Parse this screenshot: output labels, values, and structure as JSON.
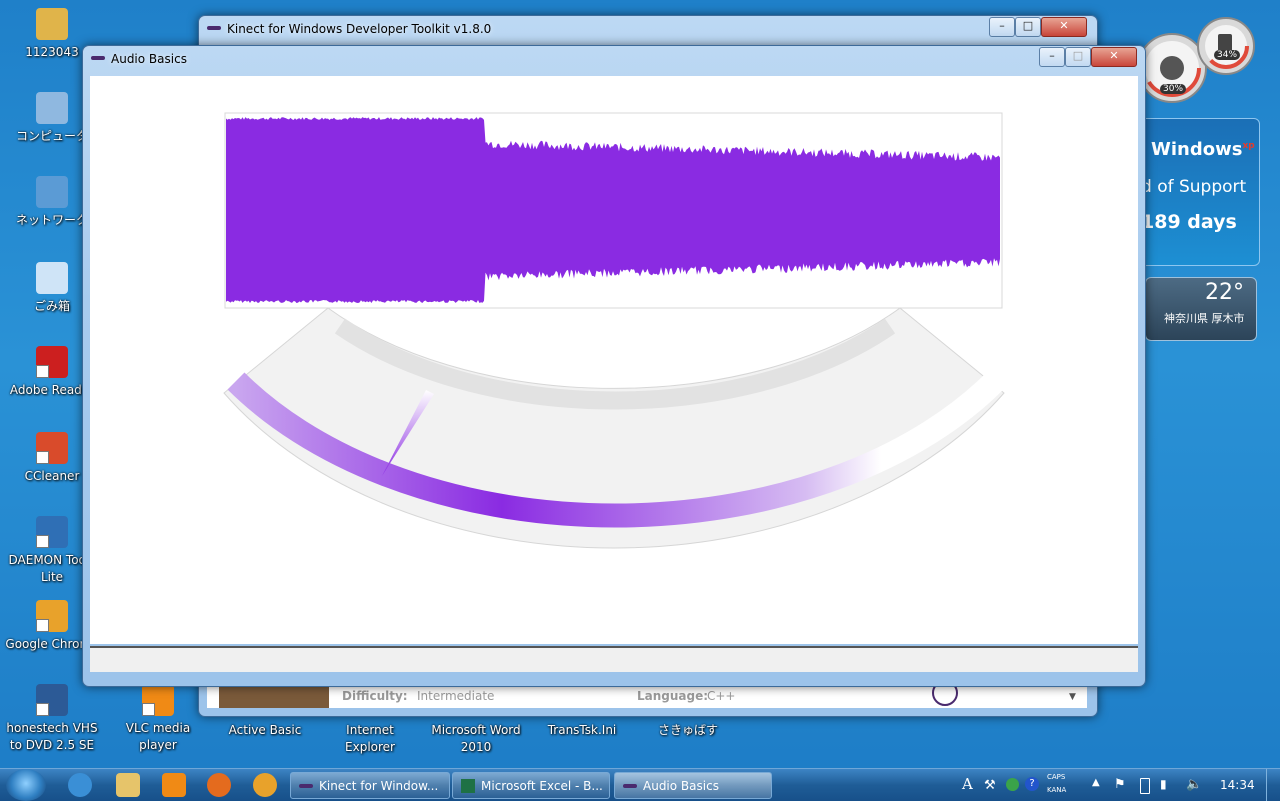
{
  "desktop": {
    "icons_left": [
      {
        "label": "1123043",
        "name": "folder-icon",
        "color": "#e0b44a"
      },
      {
        "label": "コンピュータ",
        "name": "computer-icon",
        "color": "#8fb8e0"
      },
      {
        "label": "ネットワーク",
        "name": "network-icon",
        "color": "#5b9bd5"
      },
      {
        "label": "ごみ箱",
        "name": "recycle-bin-icon",
        "color": "#cfe4f7"
      },
      {
        "label": "Adobe Reader",
        "name": "adobe-reader-icon",
        "color": "#cc1f1f"
      },
      {
        "label": "CCleaner",
        "name": "ccleaner-icon",
        "color": "#d94b2b"
      },
      {
        "label": "DAEMON Tools Lite",
        "name": "daemon-tools-icon",
        "color": "#2f6fb5"
      },
      {
        "label": "Google Chrome",
        "name": "chrome-icon",
        "color": "#e8a22b"
      },
      {
        "label": "honestech VHS to DVD 2.5 SE",
        "name": "honestech-icon",
        "color": "#2c5a96"
      }
    ],
    "icons_bottom": [
      {
        "label": "VLC media player",
        "name": "vlc-icon",
        "color": "#f08a15"
      },
      {
        "label": "Active Basic",
        "name": "active-basic-icon",
        "color": "#888"
      },
      {
        "label": "Internet Explorer",
        "name": "internet-explorer-icon",
        "color": "#3a8fd6"
      },
      {
        "label": "Microsoft Word 2010",
        "name": "word-icon",
        "color": "#2b5fb3"
      },
      {
        "label": "TransTsk.Ini",
        "name": "ini-file-icon",
        "color": "#ddd"
      },
      {
        "label": "さきゅばす",
        "name": "sakyubasu-icon",
        "color": "#bbb"
      }
    ]
  },
  "toolkit_window": {
    "title": "Kinect for Windows Developer Toolkit v1.8.0",
    "behind_text": {
      "difficulty_label": "Difficulty:",
      "difficulty_value": "Intermediate",
      "language_label": "Language:",
      "language_value": "C++"
    }
  },
  "audio_window": {
    "title": "Audio Basics",
    "waveform_color": "#8a2be2",
    "meter": {
      "beam_fraction": 0.23
    }
  },
  "gadgets": {
    "meter_cpu": "30%",
    "meter_mem": "34%",
    "support": {
      "line1": "Windows",
      "line1_suffix": "xp",
      "line2": "d of Support",
      "line3": "189 days"
    },
    "weather": {
      "temp": "22°",
      "location": "神奈川県 厚木市"
    }
  },
  "taskbar": {
    "tasks": [
      {
        "label": "Kinect for Window...",
        "name": "task-kinect-toolkit"
      },
      {
        "label": "Microsoft Excel - B...",
        "name": "task-excel"
      },
      {
        "label": "Audio Basics",
        "name": "task-audio-basics"
      }
    ],
    "tray": {
      "caps": "CAPS",
      "kana": "KANA",
      "ime": "A",
      "time": "14:34"
    }
  }
}
